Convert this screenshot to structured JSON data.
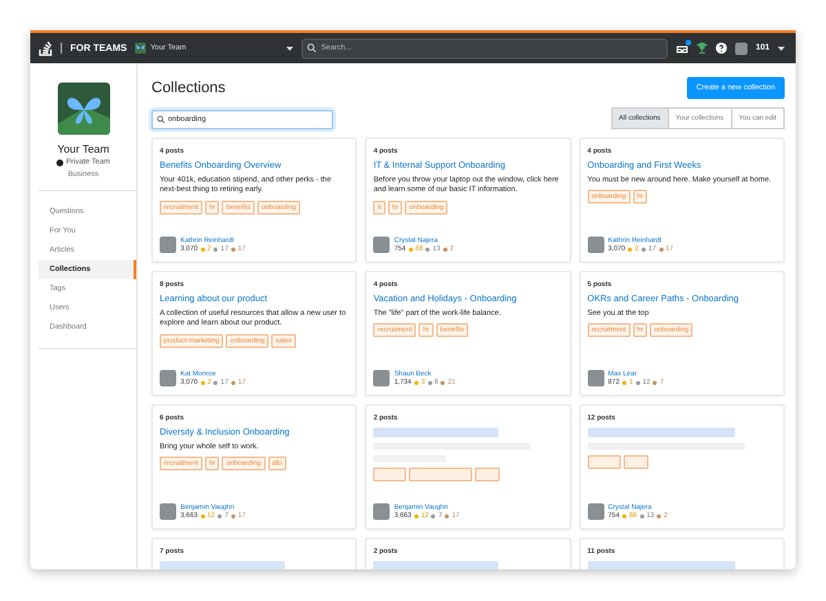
{
  "topbar": {
    "brand": "FOR TEAMS",
    "team": "Your Team",
    "search": {
      "placeholder": "Search..."
    },
    "inbox_unread": true,
    "reputation": "101"
  },
  "sidebar": {
    "team_name": "Your Team",
    "privacy": "Private Team",
    "plan": "Business",
    "items": [
      {
        "label": "Questions",
        "selected": false
      },
      {
        "label": "For You",
        "selected": false
      },
      {
        "label": "Articles",
        "selected": false
      },
      {
        "label": "Collections",
        "selected": true
      },
      {
        "label": "Tags",
        "selected": false
      },
      {
        "label": "Users",
        "selected": false
      },
      {
        "label": "Dashboard",
        "selected": false
      }
    ]
  },
  "page": {
    "title": "Collections",
    "create_button": "Create a new collection",
    "search": {
      "value": "onboarding"
    },
    "filters": [
      {
        "label": "All collections",
        "selected": true
      },
      {
        "label": "Your collections",
        "selected": false
      },
      {
        "label": "You can edit",
        "selected": false
      }
    ]
  },
  "collections": [
    {
      "kind": "full",
      "posts": "4 posts",
      "title": "Benefits Onboarding Overview",
      "description": "Your 401k, education stipend, and other perks - the next-best thing to retiring early.",
      "tags": [
        "recruitment",
        "hr",
        "benefits",
        "onboarding"
      ],
      "author": {
        "name": "Kathrin Reinhardt",
        "rep": "3,070",
        "gold": "2",
        "silver": "17",
        "bronze": "17"
      }
    },
    {
      "kind": "full",
      "posts": "4 posts",
      "title": "IT & Internal Support Onboarding",
      "description": "Before you throw your laptop out the window, click here and learn some of our basic IT information.",
      "tags": [
        "it",
        "hr",
        "onboarding"
      ],
      "author": {
        "name": "Crystal Najera",
        "rep": "754",
        "gold": "88",
        "silver": "13",
        "bronze": "2"
      }
    },
    {
      "kind": "full",
      "posts": "4 posts",
      "title": "Onboarding and First Weeks",
      "description": "You must be new around here. Make yourself at home.",
      "tags": [
        "onboarding",
        "hr"
      ],
      "author": {
        "name": "Kathrin Reinhardt",
        "rep": "3,070",
        "gold": "2",
        "silver": "17",
        "bronze": "17"
      }
    },
    {
      "kind": "full",
      "posts": "8 posts",
      "title": "Learning about our product",
      "description": "A collection of useful resources that allow a new user to explore and learn about our product.",
      "tags": [
        "product-marketing",
        "onboarding",
        "sales"
      ],
      "author": {
        "name": "Kat Monroe",
        "rep": "3,070",
        "gold": "2",
        "silver": "17",
        "bronze": "17"
      }
    },
    {
      "kind": "full",
      "posts": "4 posts",
      "title": "Vacation and Holidays - Onboarding",
      "description": "The \"life\" part of the work-life balance.",
      "tags": [
        "recruitment",
        "hr",
        "benefits"
      ],
      "author": {
        "name": "Shaun Beck",
        "rep": "1,734",
        "gold": "3",
        "silver": "6",
        "bronze": "21"
      }
    },
    {
      "kind": "full",
      "posts": "5 posts",
      "title": "OKRs and Career Paths - Onboarding",
      "description": "See you at the top",
      "tags": [
        "recruitment",
        "hr",
        "onboarding"
      ],
      "author": {
        "name": "Max Lear",
        "rep": "872",
        "gold": "1",
        "silver": "12",
        "bronze": "7"
      }
    },
    {
      "kind": "full",
      "posts": "6 posts",
      "title": "Diversity & Inclusion Onboarding",
      "description": "Bring your whole self to work.",
      "tags": [
        "recruitment",
        "hr",
        "onboarding",
        "d&i"
      ],
      "author": {
        "name": "Benjamin Vaughn",
        "rep": "3,663",
        "gold": "12",
        "silver": "7",
        "bronze": "17"
      }
    },
    {
      "kind": "loading",
      "posts": "2 posts",
      "author": {
        "name": "Benjamin Vaughn",
        "rep": "3,663",
        "gold": "12",
        "silver": "7",
        "bronze": "17"
      }
    },
    {
      "kind": "loading",
      "posts": "12 posts",
      "author": {
        "name": "Crystal Najera",
        "rep": "754",
        "gold": "88",
        "silver": "13",
        "bronze": "2"
      }
    },
    {
      "kind": "loading",
      "posts": "7 posts"
    },
    {
      "kind": "loading",
      "posts": "2 posts"
    },
    {
      "kind": "loading",
      "posts": "11 posts"
    }
  ]
}
